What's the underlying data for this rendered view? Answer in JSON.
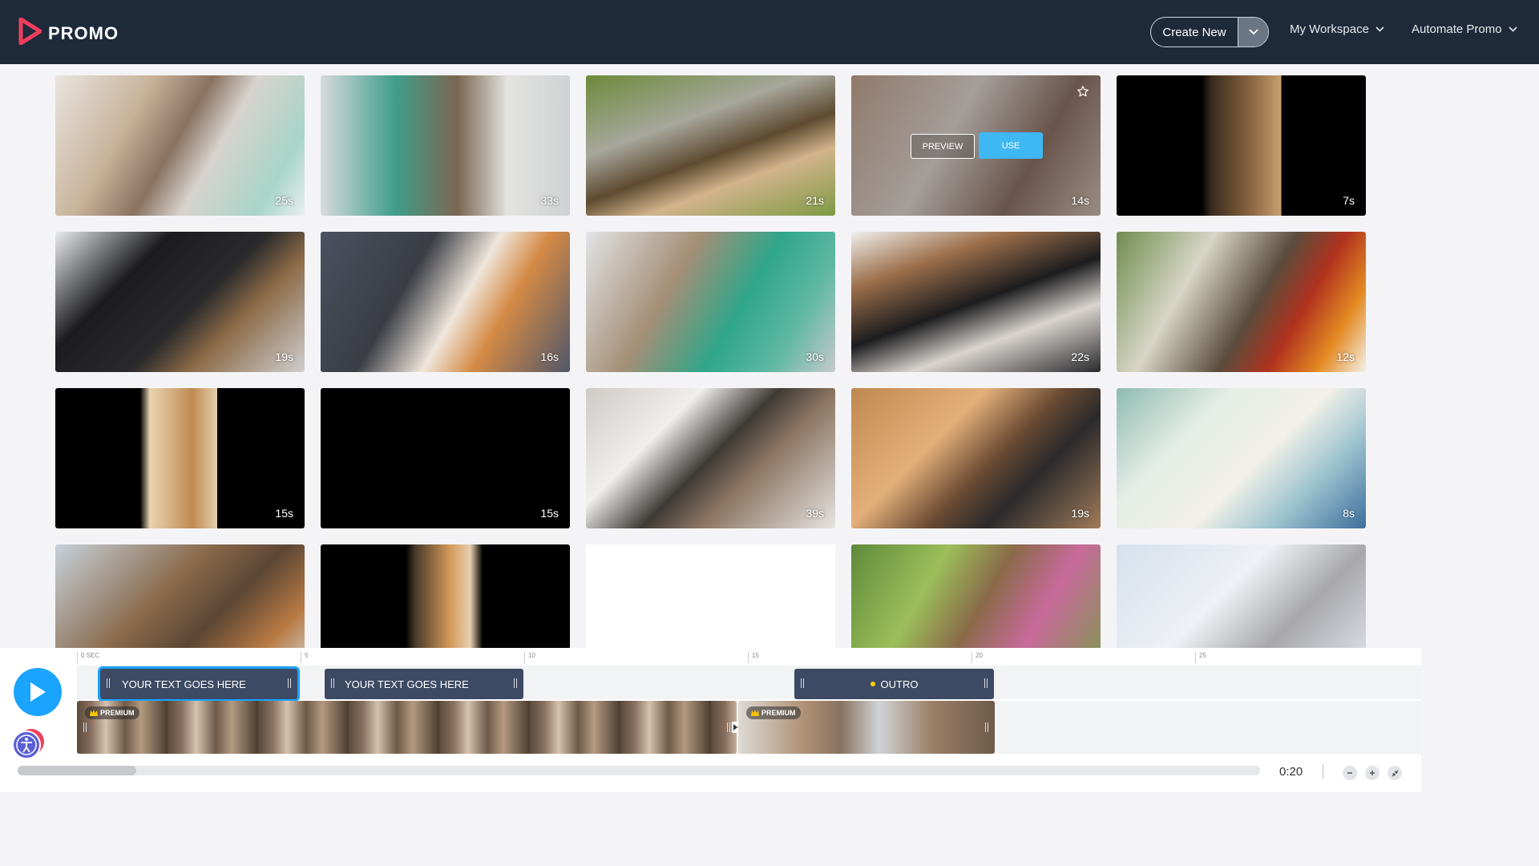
{
  "header": {
    "brand": "PROMO",
    "create_new": "Create New",
    "workspace": "My Workspace",
    "automate": "Automate Promo"
  },
  "tiles": [
    {
      "duration": "25s"
    },
    {
      "duration": "33s"
    },
    {
      "duration": "21s"
    },
    {
      "duration": "14s",
      "preview_label": "PREVIEW",
      "use_label": "USE"
    },
    {
      "duration": "7s"
    },
    {
      "duration": "19s"
    },
    {
      "duration": "16s"
    },
    {
      "duration": "30s"
    },
    {
      "duration": "22s"
    },
    {
      "duration": "12s"
    },
    {
      "duration": "15s"
    },
    {
      "duration": "15s"
    },
    {
      "duration": "39s"
    },
    {
      "duration": "19s"
    },
    {
      "duration": "8s"
    },
    {
      "duration": ""
    },
    {
      "duration": ""
    },
    {
      "duration": ""
    },
    {
      "duration": ""
    },
    {
      "duration": ""
    }
  ],
  "timeline": {
    "ruler": [
      "0 SEC",
      "5",
      "10",
      "15",
      "20",
      "25"
    ],
    "text_clips": [
      {
        "label": "YOUR TEXT GOES HERE"
      },
      {
        "label": "YOUR TEXT GOES HERE"
      },
      {
        "label": "OUTRO"
      }
    ],
    "video_clips": [
      {
        "badge": "PREMIUM"
      },
      {
        "badge": "PREMIUM"
      }
    ],
    "time": "0:20"
  },
  "colors": {
    "header_bg": "#1e2a3a",
    "accent": "#1aa3ff",
    "brand": "#ef3e5c",
    "clip": "#3d4a63"
  }
}
